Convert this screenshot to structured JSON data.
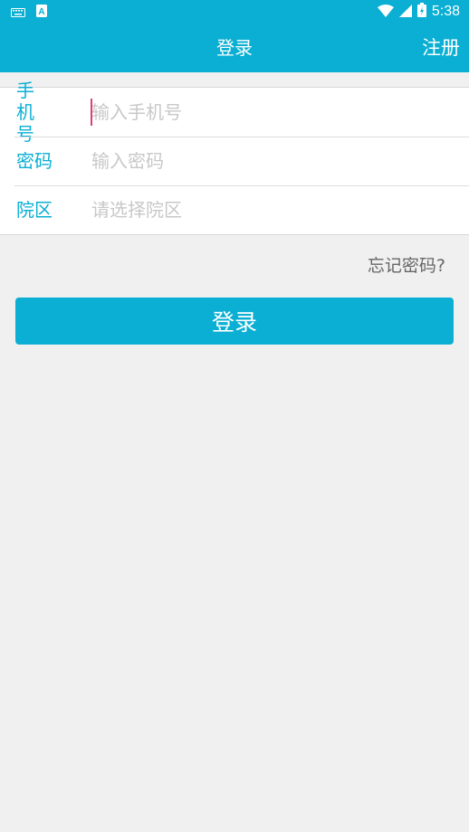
{
  "status_bar": {
    "time": "5:38",
    "icons": [
      "keyboard-icon",
      "a-app-icon",
      "wifi-icon",
      "signal-icon",
      "battery-charging-icon"
    ]
  },
  "app_bar": {
    "title": "登录",
    "register_label": "注册"
  },
  "form": {
    "phone": {
      "label": "手机号",
      "placeholder": "输入手机号"
    },
    "password": {
      "label": "密码",
      "placeholder": "输入密码"
    },
    "campus": {
      "label": "院区",
      "placeholder": "请选择院区"
    }
  },
  "forgot_password_label": "忘记密码?",
  "login_button_label": "登录",
  "colors": {
    "accent": "#0aafd3",
    "cursor": "#e23c7a",
    "background": "#f0f0f0"
  }
}
